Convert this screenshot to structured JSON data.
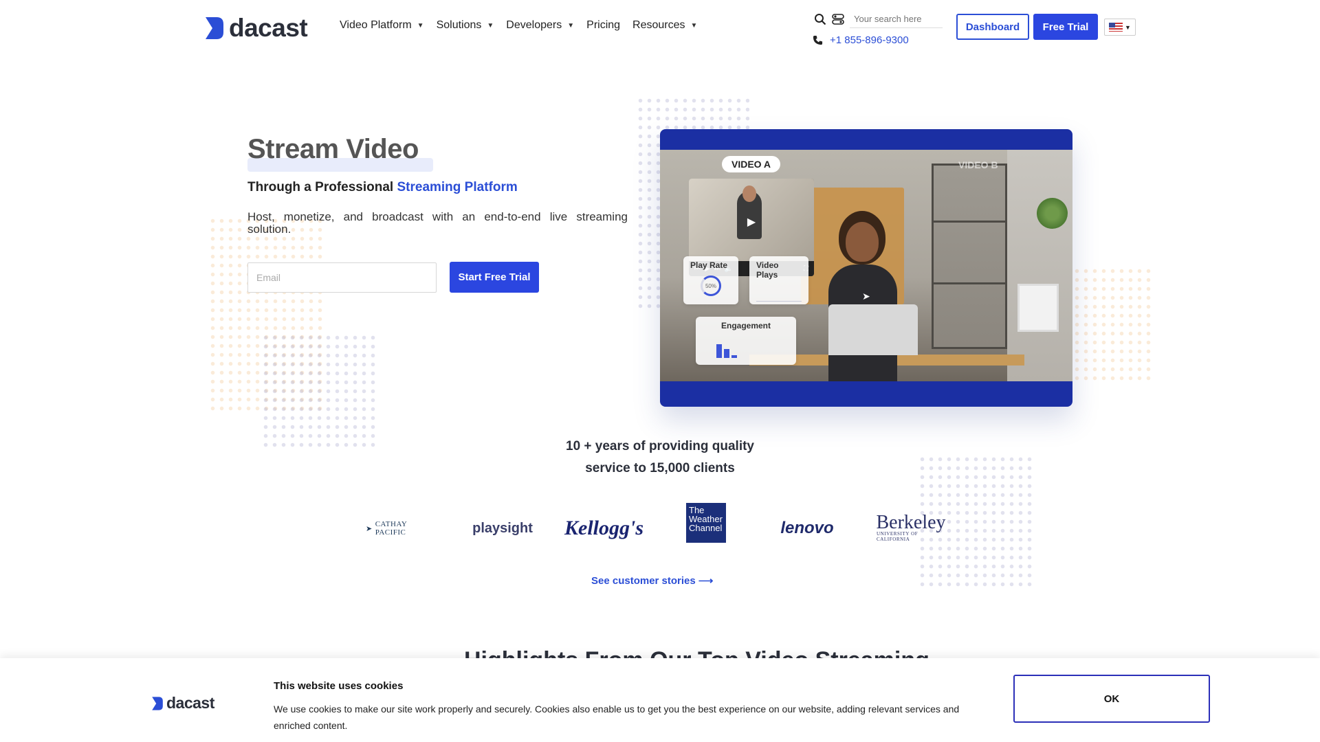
{
  "header": {
    "brand": "dacast",
    "nav": [
      {
        "label": "Video Platform",
        "has_menu": true
      },
      {
        "label": "Solutions",
        "has_menu": true
      },
      {
        "label": "Developers",
        "has_menu": true
      },
      {
        "label": "Pricing",
        "has_menu": false
      },
      {
        "label": "Resources",
        "has_menu": true
      }
    ],
    "search_placeholder": "Your search here",
    "phone": "+1 855-896-9300",
    "dashboard_label": "Dashboard",
    "free_trial_label": "Free Trial",
    "language_flag": "us-flag-icon"
  },
  "hero": {
    "title": "Stream Video",
    "subtitle_prefix": "Through a Professional ",
    "subtitle_accent": "Streaming Platform",
    "description": "Host, monetize, and broadcast with an end-to-end live streaming solution.",
    "email_placeholder": "Email",
    "cta_label": "Start Free Trial"
  },
  "video_mockup": {
    "video_a_label": "VIDEO A",
    "video_b_label": "VIDEO B",
    "play_rate_label": "Play Rate",
    "play_rate_value": "50%",
    "video_plays_label": "Video Plays",
    "engagement_label": "Engagement",
    "engagement_bars": [
      0.7,
      0.45,
      0.15
    ]
  },
  "stats": {
    "line1": "10 + years of providing quality",
    "line2": "service to 15,000 clients"
  },
  "clients": {
    "cathay": "CATHAY PACIFIC",
    "playsight": "playsight",
    "kelloggs": "Kellogg's",
    "weather_line1": "The",
    "weather_line2": "Weather",
    "weather_line3": "Channel",
    "lenovo": "lenovo",
    "berkeley": "Berkeley",
    "berkeley_sub": "UNIVERSITY OF CALIFORNIA"
  },
  "stories_link": "See customer stories ⟶",
  "next_section_heading": "Highlights From Our Top Video Streaming",
  "cookie": {
    "brand": "dacast",
    "title": "This website uses cookies",
    "text": "We use cookies to make our site work properly and securely. Cookies also enable us to get you the best experience on our website, adding relevant services and enriched content.",
    "ok_label": "OK"
  },
  "colors": {
    "accent": "#2b4ed6",
    "button": "#2b46e0",
    "video_frame": "#1b2fa3"
  }
}
